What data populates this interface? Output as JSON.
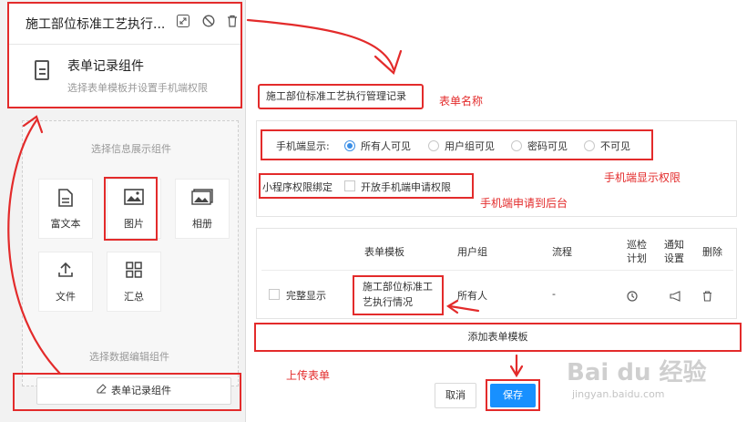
{
  "left_panel": {
    "header": {
      "title": "施工部位标准工艺执行...",
      "icons": [
        "shrink-icon",
        "disable-icon",
        "trash-icon"
      ]
    },
    "component": {
      "title": "表单记录组件",
      "description": "选择表单模板并设置手机端权限",
      "icon": "document-icon"
    },
    "info_section_label": "选择信息展示组件",
    "tiles": [
      {
        "label": "富文本",
        "icon": "rich-text-icon"
      },
      {
        "label": "图片",
        "icon": "image-icon"
      },
      {
        "label": "相册",
        "icon": "album-icon"
      },
      {
        "label": "文件",
        "icon": "upload-icon"
      },
      {
        "label": "汇总",
        "icon": "grid-icon"
      }
    ],
    "data_section_label": "选择数据编辑组件",
    "form_button_label": "表单记录组件"
  },
  "right_panel": {
    "form_name_value": "施工部位标准工艺执行管理记录",
    "mobile_display_label": "手机端显示:",
    "mobile_options": [
      "所有人可见",
      "用户组可见",
      "密码可见",
      "不可见"
    ],
    "mobile_selected": "所有人可见",
    "mini_program_label": "小程序权限绑定",
    "mini_program_checkbox": "开放手机端申请权限",
    "table": {
      "headers": [
        "表单模板",
        "用户组",
        "流程",
        "巡检计划",
        "通知设置",
        "删除"
      ],
      "row": {
        "checkbox_label": "完整显示",
        "template": "施工部位标准工艺执行情况",
        "user_group": "所有人",
        "flow": "-"
      }
    },
    "add_template_label": "添加表单模板",
    "cancel_label": "取消",
    "save_label": "保存"
  },
  "annotations": {
    "form_name": "表单名称",
    "mobile_permission": "手机端显示权限",
    "apply_backend": "手机端申请到后台",
    "upload_form": "上传表单"
  },
  "watermark": {
    "brand": "Bai du 经验",
    "url": "jingyan.baidu.com"
  },
  "colors": {
    "annotation_red": "#e32b2b",
    "primary_blue": "#1890ff",
    "radio_blue": "#3a8ee6"
  }
}
